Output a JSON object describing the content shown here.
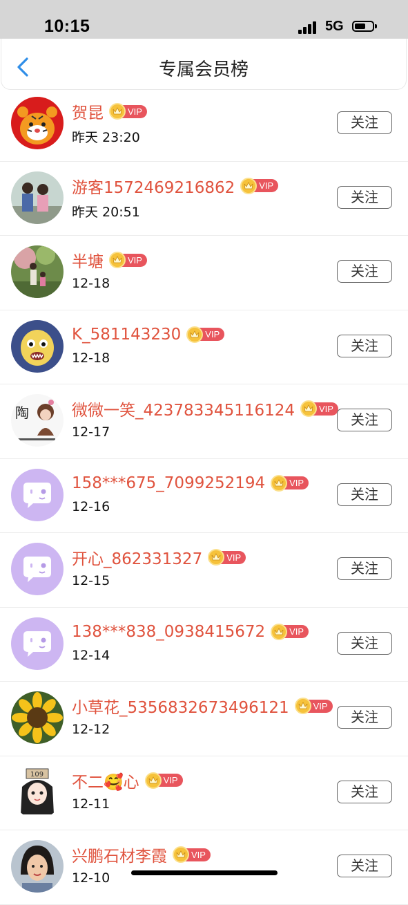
{
  "status_bar": {
    "time": "10:15",
    "network": "5G"
  },
  "header": {
    "title": "专属会员榜"
  },
  "vip_label": "VIP",
  "follow_label": "关注",
  "members": [
    {
      "name": "贺昆",
      "date": "昨天 23:20",
      "avatar": "tiger-avatar"
    },
    {
      "name": "游客1572469216862",
      "date": "昨天 20:51",
      "avatar": "kids-photo-avatar"
    },
    {
      "name": "半塘",
      "date": "12-18",
      "avatar": "garden-photo-avatar"
    },
    {
      "name": "K_581143230",
      "date": "12-18",
      "avatar": "plush-toy-avatar"
    },
    {
      "name": "微微一笑_423783345116124",
      "date": "12-17",
      "avatar": "cartoon-girl-avatar"
    },
    {
      "name": "158***675_7099252194",
      "date": "12-16",
      "avatar": "default-chat-avatar"
    },
    {
      "name": "开心_862331327",
      "date": "12-15",
      "avatar": "default-chat-avatar"
    },
    {
      "name": "138***838_0938415672",
      "date": "12-14",
      "avatar": "default-chat-avatar"
    },
    {
      "name": "小草花_5356832673496121",
      "date": "12-12",
      "avatar": "sunflower-avatar"
    },
    {
      "name": "不二🥰心",
      "date": "12-11",
      "avatar": "anime-girl-avatar"
    },
    {
      "name": "兴鹏石材李霞",
      "date": "12-10",
      "avatar": "woman-portrait-avatar"
    }
  ],
  "colors": {
    "name": "#e0533e",
    "vip_tag": "#e8555d",
    "crown": "#f6c23b",
    "back": "#2f8ee8",
    "default_avatar": "#cdb6f2"
  }
}
